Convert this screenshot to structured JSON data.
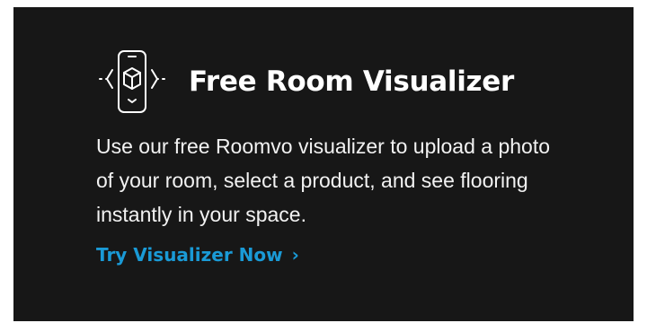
{
  "promo": {
    "title": "Free Room Visualizer",
    "description": "Use our free Roomvo visualizer to upload a photo of your room, select a product, and see flooring instantly in your space.",
    "cta_label": "Try Visualizer Now",
    "cta_chevron": "›"
  },
  "colors": {
    "background": "#171717",
    "title": "#ffffff",
    "body_text": "#f2f2f2",
    "link": "#1a9ad6"
  },
  "icons": {
    "header_icon": "phone-ar-cube-icon",
    "cta_icon": "chevron-right-icon"
  }
}
